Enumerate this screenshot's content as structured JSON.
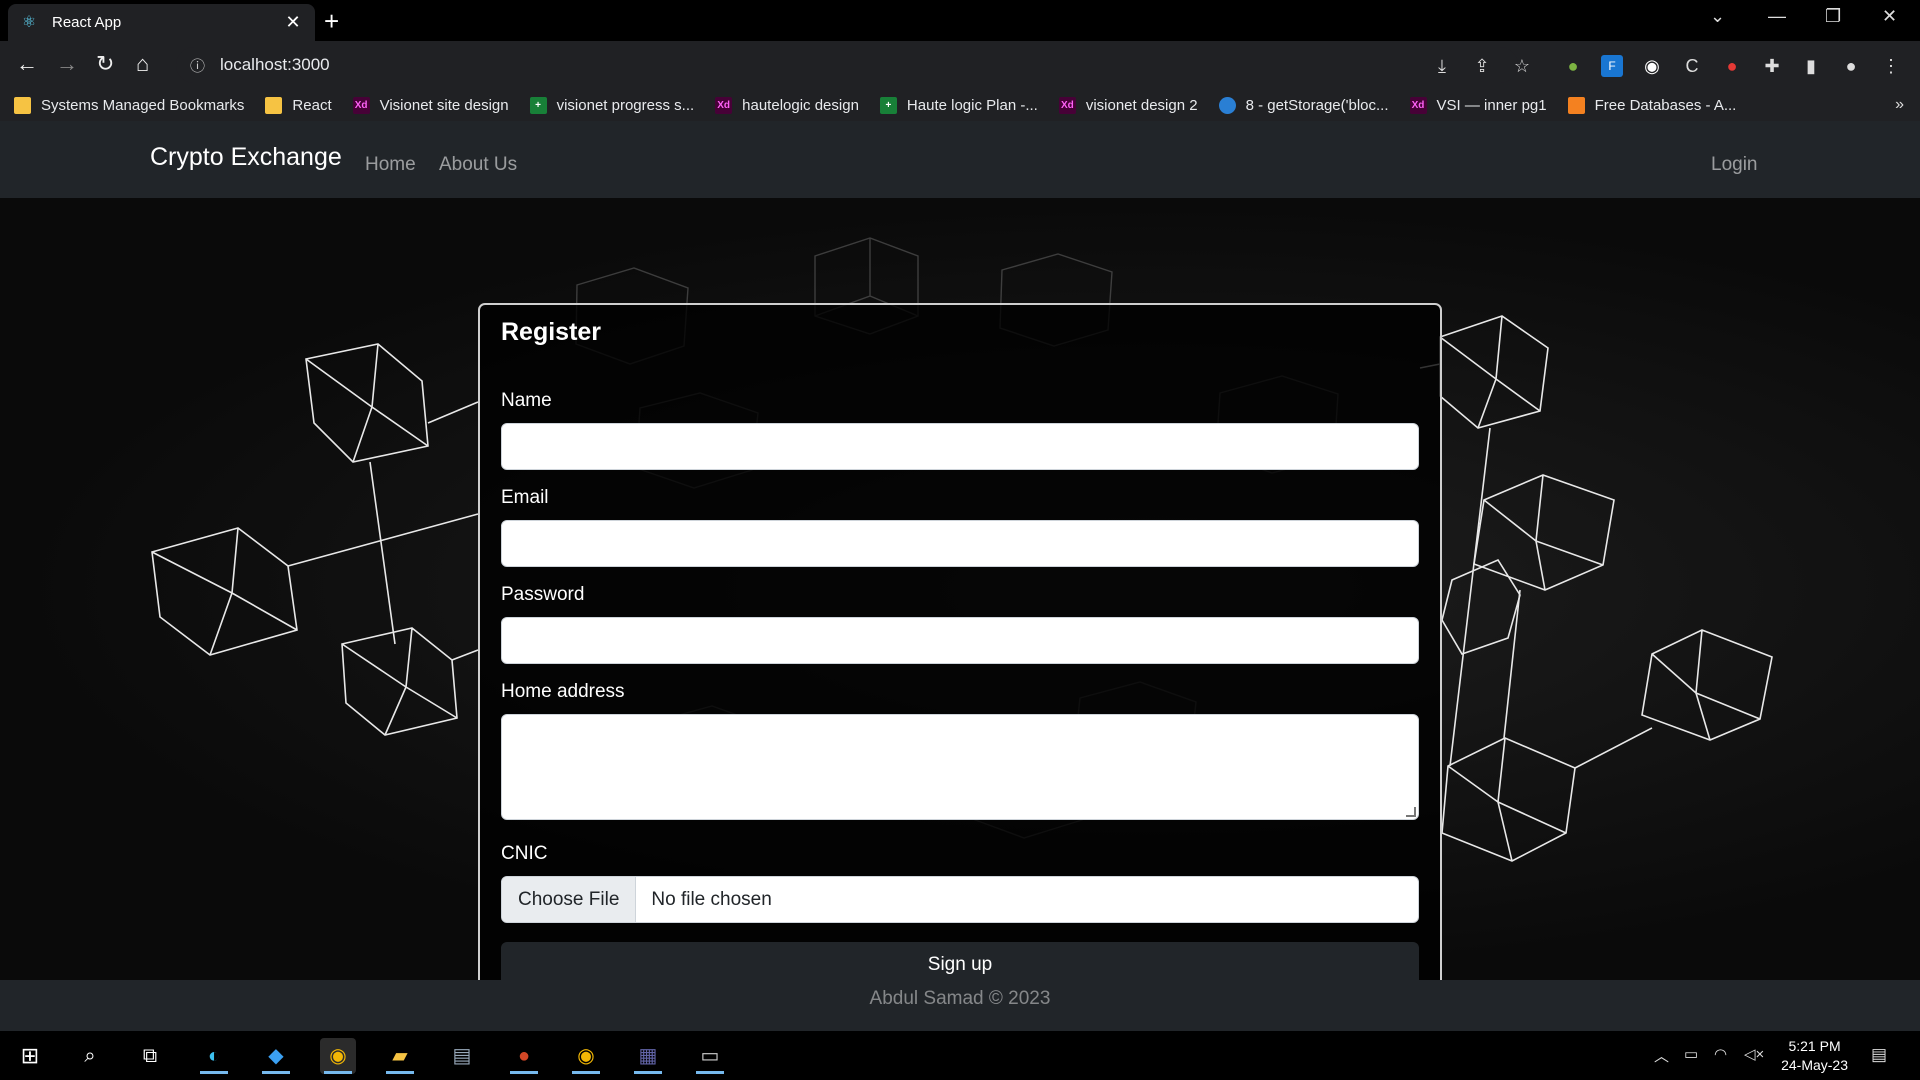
{
  "browser": {
    "tab_title": "React App",
    "url": "localhost:3000",
    "bookmarks": [
      {
        "label": "Systems Managed Bookmarks",
        "icon": "folder-icon"
      },
      {
        "label": "React",
        "icon": "folder-icon"
      },
      {
        "label": "Visionet site design",
        "icon": "xd-icon"
      },
      {
        "label": "visionet progress s...",
        "icon": "sheets-icon"
      },
      {
        "label": "hautelogic design",
        "icon": "xd-icon"
      },
      {
        "label": "Haute logic Plan -...",
        "icon": "sheets-icon"
      },
      {
        "label": "visionet design 2",
        "icon": "xd-icon"
      },
      {
        "label": "8 - getStorage('bloc...",
        "icon": "drop-icon"
      },
      {
        "label": "VSI — inner pg1",
        "icon": "xd-icon"
      },
      {
        "label": "Free Databases - A...",
        "icon": "hex-icon"
      }
    ]
  },
  "app": {
    "brand": "Crypto Exchange",
    "nav": {
      "home": "Home",
      "about": "About Us",
      "login": "Login"
    },
    "form": {
      "title": "Register",
      "name_label": "Name",
      "email_label": "Email",
      "password_label": "Password",
      "address_label": "Home address",
      "cnic_label": "CNIC",
      "choose_file": "Choose File",
      "no_file": "No file chosen",
      "submit": "Sign up"
    },
    "footer": "Abdul Samad © 2023"
  },
  "taskbar": {
    "time": "5:21 PM",
    "date": "24-May-23"
  },
  "colors": {
    "navbar": "#212529",
    "accent_button": "#212529"
  }
}
